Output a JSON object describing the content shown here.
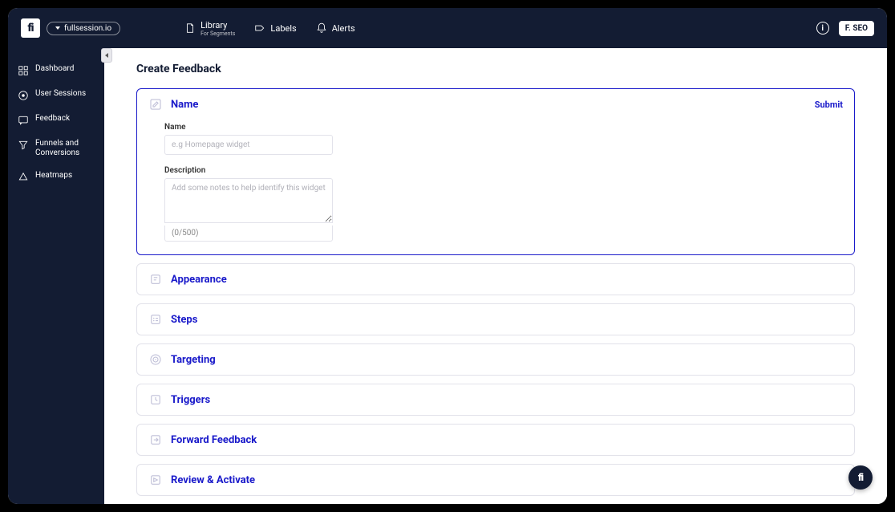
{
  "header": {
    "site_label": "fullsession.io",
    "nav": {
      "library": {
        "label": "Library",
        "sub": "For Segments"
      },
      "labels": {
        "label": "Labels"
      },
      "alerts": {
        "label": "Alerts"
      }
    },
    "user_chip": "F. SEO"
  },
  "sidebar": {
    "items": [
      {
        "label": "Dashboard"
      },
      {
        "label": "User Sessions"
      },
      {
        "label": "Feedback"
      },
      {
        "label": "Funnels and Conversions"
      },
      {
        "label": "Heatmaps"
      }
    ]
  },
  "main": {
    "page_title": "Create Feedback",
    "submit_label": "Submit",
    "panels": [
      {
        "title": "Name"
      },
      {
        "title": "Appearance"
      },
      {
        "title": "Steps"
      },
      {
        "title": "Targeting"
      },
      {
        "title": "Triggers"
      },
      {
        "title": "Forward Feedback"
      },
      {
        "title": "Review & Activate"
      }
    ],
    "form": {
      "name_label": "Name",
      "name_placeholder": "e.g Homepage widget",
      "desc_label": "Description",
      "desc_placeholder": "Add some notes to help identify this widget",
      "char_count": "(0/500)"
    }
  }
}
